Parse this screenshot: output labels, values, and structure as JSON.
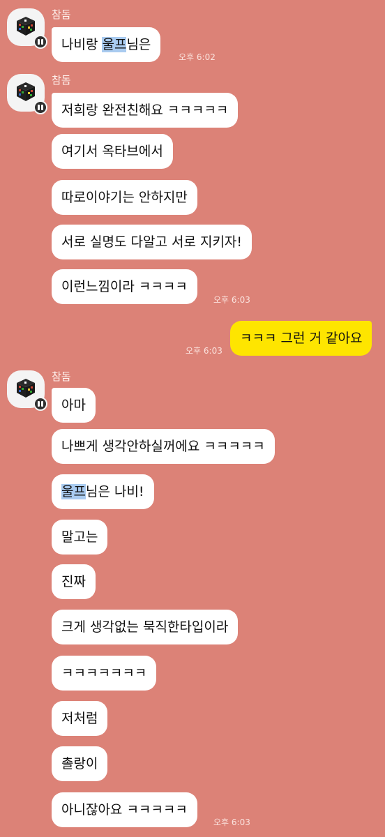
{
  "groups": [
    {
      "sender": "참돔",
      "messages": [
        {
          "pre": "나비랑 ",
          "hl": "울프",
          "post": "님은"
        }
      ],
      "time": "오후 6:02"
    },
    {
      "sender": "참돔",
      "messages": [
        {
          "text": "저희랑 완전친해요 ㅋㅋㅋㅋㅋ"
        },
        {
          "text": "여기서 옥타브에서"
        },
        {
          "text": "따로이야기는 안하지만"
        },
        {
          "text": "서로 실명도 다알고 서로 지키자!"
        },
        {
          "text": "이런느낌이라 ㅋㅋㅋㅋ"
        }
      ],
      "time": "오후 6:03"
    },
    {
      "mine": true,
      "messages": [
        {
          "text": "ㅋㅋㅋ 그런 거 같아요"
        }
      ],
      "time": "오후 6:03"
    },
    {
      "sender": "참돔",
      "messages": [
        {
          "text": "아마"
        },
        {
          "text": "나쁘게 생각안하실꺼에요 ㅋㅋㅋㅋㅋ"
        },
        {
          "pre": "",
          "hl": "울프",
          "post": "님은 나비!"
        },
        {
          "text": "말고는"
        },
        {
          "text": "진짜"
        },
        {
          "text": "크게 생각없는 묵직한타입이라"
        },
        {
          "text": "ㅋㅋㅋㅋㅋㅋㅋ"
        },
        {
          "text": "저처럼"
        },
        {
          "text": "촐랑이"
        },
        {
          "text": "아니잖아요 ㅋㅋㅋㅋㅋ"
        }
      ],
      "time": "오후 6:03"
    }
  ],
  "colors": {
    "background": "#dc8277",
    "incoming_bubble": "#ffffff",
    "outgoing_bubble": "#fee500",
    "mention_highlight": "#a9cbf0"
  },
  "icons": {
    "avatar": "rubiks-cube",
    "badge": "chat-bubble-icon"
  }
}
